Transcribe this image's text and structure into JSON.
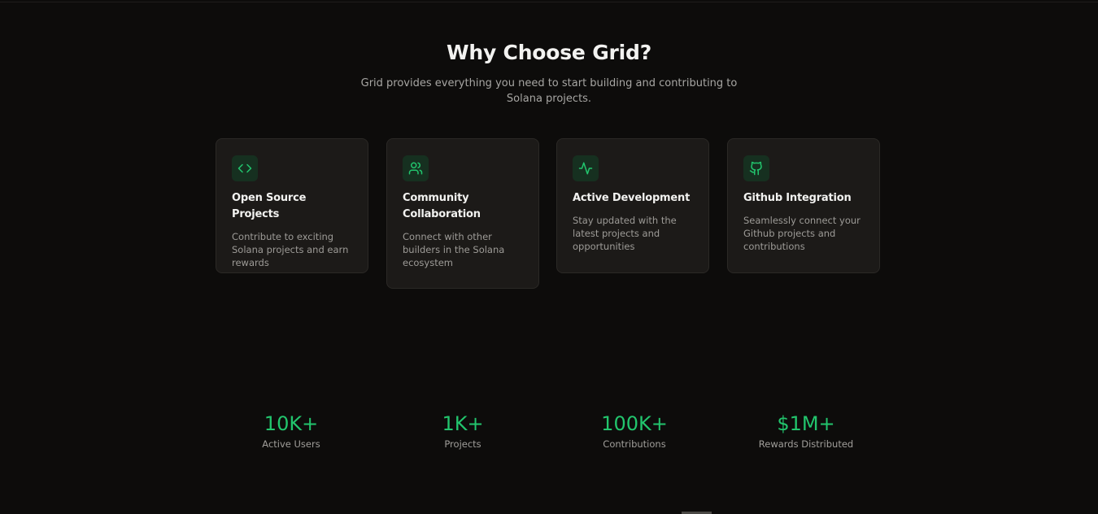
{
  "section": {
    "heading": "Why Choose Grid?",
    "subheading": "Grid provides everything you need to start building and contributing to Solana projects."
  },
  "features": [
    {
      "icon": "code-icon",
      "title": "Open Source Projects",
      "description": "Contribute to exciting Solana projects and earn rewards"
    },
    {
      "icon": "users-icon",
      "title": "Community Collaboration",
      "description": "Connect with other builders in the Solana ecosystem"
    },
    {
      "icon": "activity-icon",
      "title": "Active Development",
      "description": "Stay updated with the latest projects and opportunities"
    },
    {
      "icon": "github-icon",
      "title": "Github Integration",
      "description": "Seamlessly connect your Github projects and contributions"
    }
  ],
  "stats": [
    {
      "value": "10K+",
      "label": "Active Users"
    },
    {
      "value": "1K+",
      "label": "Projects"
    },
    {
      "value": "100K+",
      "label": "Contributions"
    },
    {
      "value": "$1M+",
      "label": "Rewards Distributed"
    }
  ],
  "colors": {
    "accent": "#22c56d",
    "background": "#0d0c0b",
    "card": "#1c1a18"
  }
}
